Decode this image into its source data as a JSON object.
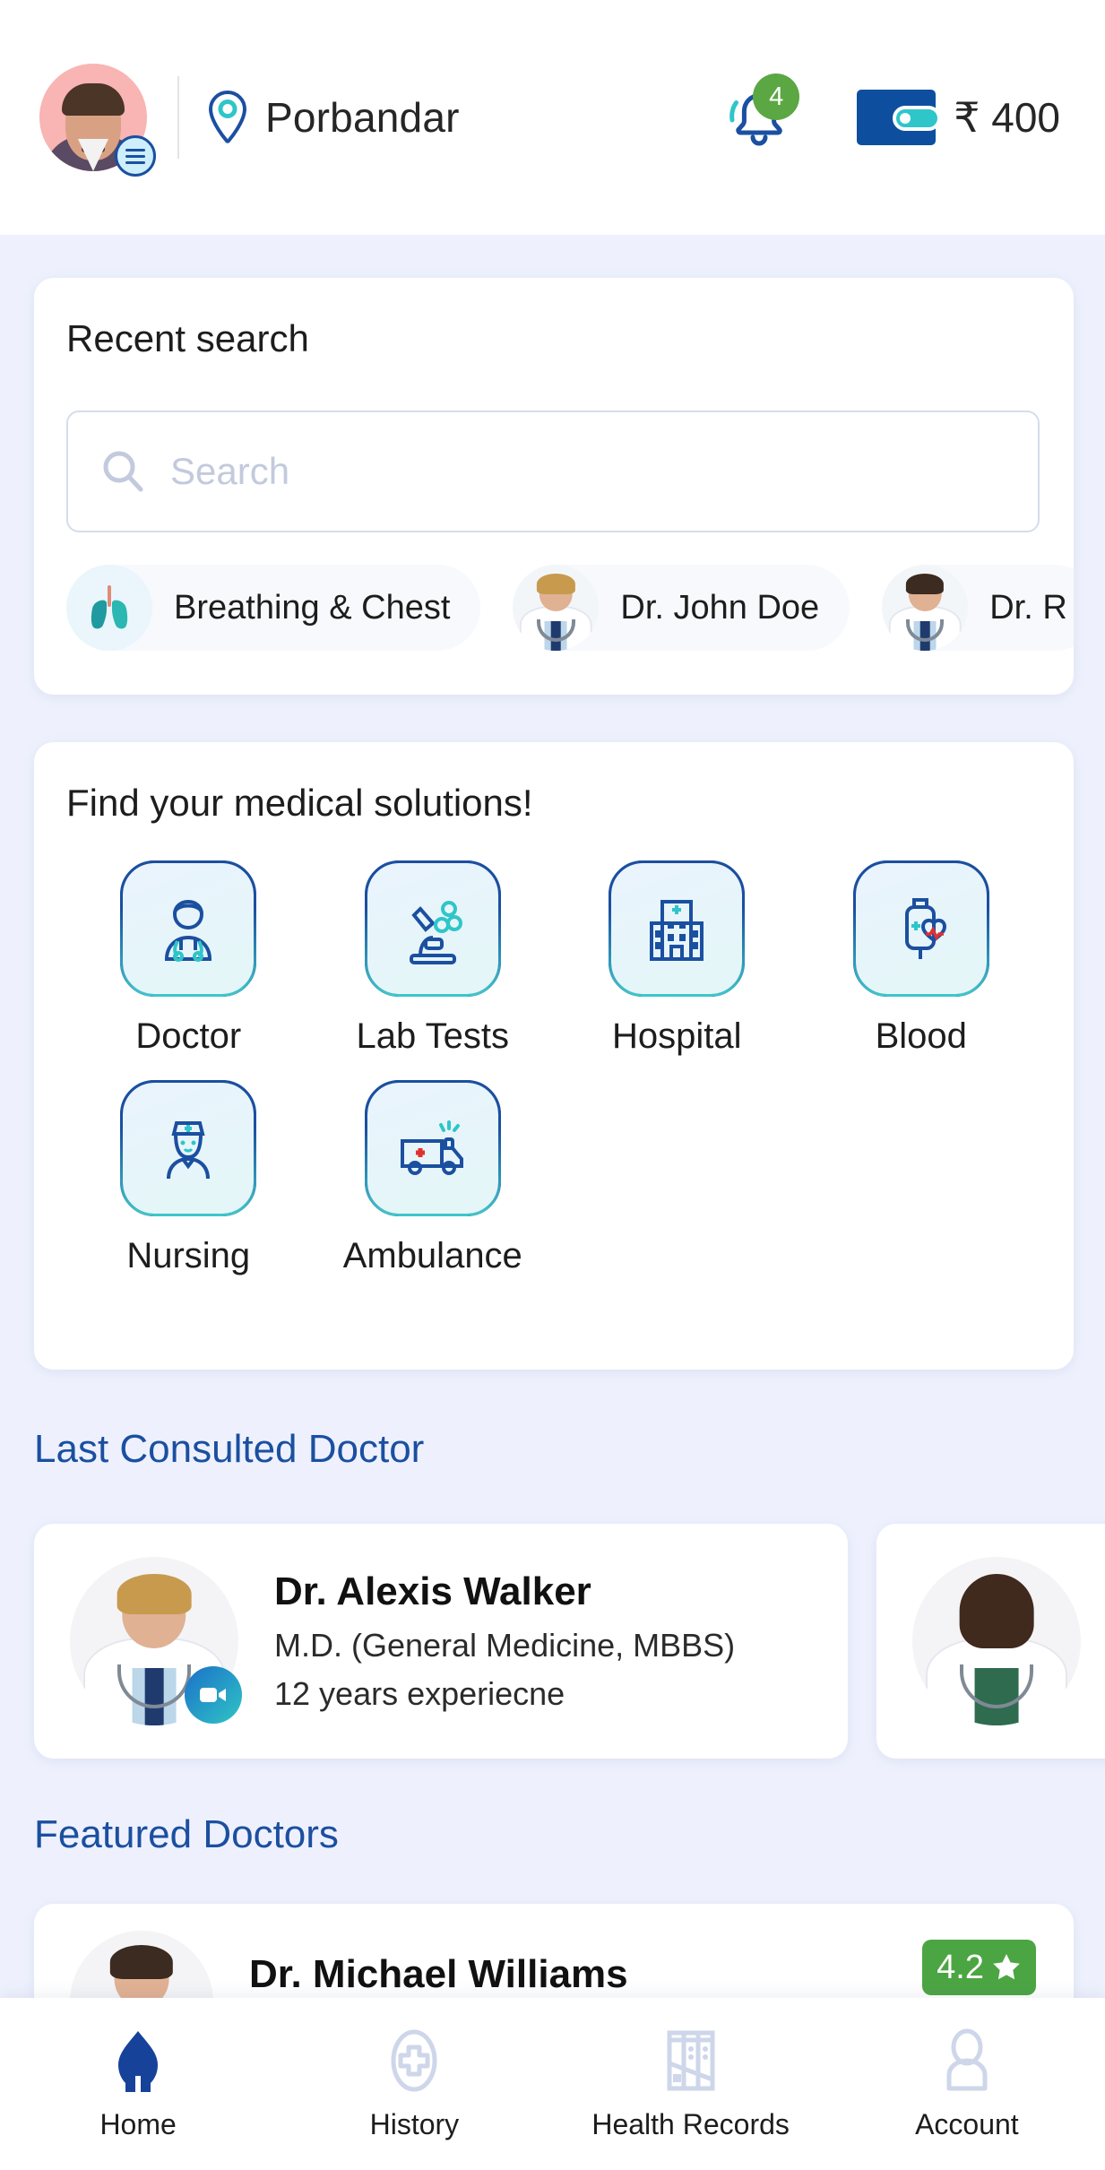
{
  "header": {
    "city": "Porbandar",
    "location_icon": "location-pin-icon",
    "avatar_icon": "user-avatar",
    "menu_icon": "hamburger-menu-icon",
    "bell_icon": "notification-bell-icon",
    "notification_count": "4",
    "wallet_icon": "wallet-icon",
    "wallet_amount": "₹ 400"
  },
  "recent": {
    "title": "Recent search",
    "search_placeholder": "Search",
    "search_value": "",
    "search_icon": "search-icon",
    "chips": [
      {
        "label": "Breathing & Chest",
        "icon": "lungs-icon"
      },
      {
        "label": "Dr. John Doe",
        "icon": "doctor-photo"
      },
      {
        "label": "Dr. R",
        "icon": "doctor-photo"
      }
    ]
  },
  "solutions": {
    "title": "Find your medical solutions!",
    "items": [
      {
        "label": "Doctor",
        "icon": "doctor-icon"
      },
      {
        "label": "Lab Tests",
        "icon": "microscope-icon"
      },
      {
        "label": "Hospital",
        "icon": "hospital-icon"
      },
      {
        "label": "Blood",
        "icon": "blood-bag-heart-icon"
      },
      {
        "label": "Nursing",
        "icon": "nurse-icon"
      },
      {
        "label": "Ambulance",
        "icon": "ambulance-icon"
      }
    ]
  },
  "last_consulted": {
    "heading": "Last Consulted Doctor",
    "doctors": [
      {
        "name": "Dr. Alexis Walker",
        "degree": "M.D. (General Medicine, MBBS)",
        "experience": "12 years experiecne",
        "video_icon": "video-call-icon",
        "photo": "male-doctor-photo"
      },
      {
        "name": "",
        "degree": "",
        "experience": "",
        "video_icon": "video-call-icon",
        "photo": "female-doctor-photo"
      }
    ]
  },
  "featured": {
    "heading": "Featured Doctors",
    "doctors": [
      {
        "name": "Dr. Michael Williams",
        "rating": "4.2",
        "star_icon": "star-icon",
        "photo": "male-doctor-photo"
      }
    ]
  },
  "bottom_nav": {
    "items": [
      {
        "label": "Home",
        "icon": "home-icon",
        "active": true
      },
      {
        "label": "History",
        "icon": "history-cross-icon",
        "active": false
      },
      {
        "label": "Health Records",
        "icon": "health-records-icon",
        "active": false
      },
      {
        "label": "Account",
        "icon": "account-person-icon",
        "active": false
      }
    ]
  },
  "colors": {
    "page_bg": "#eef1fd",
    "primary_navy": "#1b4fa0",
    "accent_teal": "#3fc8c9",
    "rating_green": "#4ca543",
    "badge_green": "#5ba743",
    "nav_inactive": "#ced6ea"
  }
}
